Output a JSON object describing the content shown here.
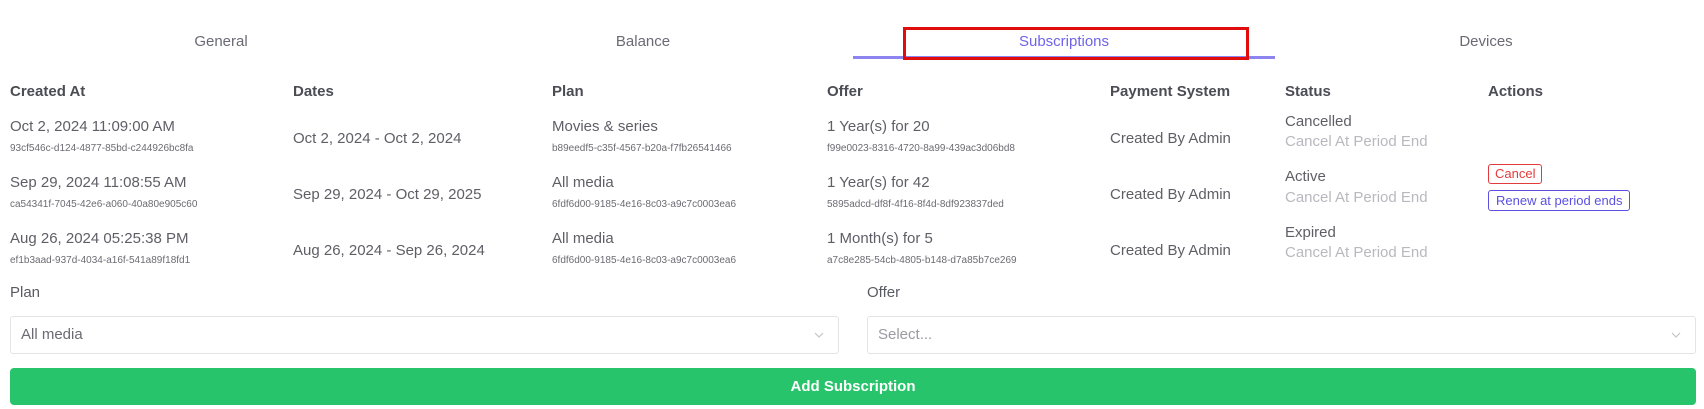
{
  "tabs": [
    {
      "label": "General"
    },
    {
      "label": "Balance"
    },
    {
      "label": "Subscriptions"
    },
    {
      "label": "Devices"
    }
  ],
  "active_tab": "Subscriptions",
  "table": {
    "headers": {
      "created_at": "Created At",
      "dates": "Dates",
      "plan": "Plan",
      "offer": "Offer",
      "payment_system": "Payment System",
      "status": "Status",
      "actions": "Actions"
    },
    "rows": [
      {
        "created_at": "Oct 2, 2024 11:09:00 AM",
        "id": "93cf546c-d124-4877-85bd-c244926bc8fa",
        "dates": "Oct 2, 2024 - Oct 2, 2024",
        "plan": "Movies & series",
        "plan_id": "b89eedf5-c35f-4567-b20a-f7fb26541466",
        "offer": "1 Year(s) for 20",
        "offer_id": "f99e0023-8316-4720-8a99-439ac3d06bd8",
        "payment_system": "Created By Admin",
        "status": "Cancelled",
        "status_note": "Cancel At Period End"
      },
      {
        "created_at": "Sep 29, 2024 11:08:55 AM",
        "id": "ca54341f-7045-42e6-a060-40a80e905c60",
        "dates": "Sep 29, 2024 - Oct 29, 2025",
        "plan": "All media",
        "plan_id": "6fdf6d00-9185-4e16-8c03-a9c7c0003ea6",
        "offer": "1 Year(s) for 42",
        "offer_id": "5895adcd-df8f-4f16-8f4d-8df923837ded",
        "payment_system": "Created By Admin",
        "status": "Active",
        "status_note": "Cancel At Period End",
        "actions": {
          "cancel": "Cancel",
          "renew": "Renew at period ends"
        }
      },
      {
        "created_at": "Aug 26, 2024 05:25:38 PM",
        "id": "ef1b3aad-937d-4034-a16f-541a89f18fd1",
        "dates": "Aug 26, 2024 - Sep 26, 2024",
        "plan": "All media",
        "plan_id": "6fdf6d00-9185-4e16-8c03-a9c7c0003ea6",
        "offer": "1 Month(s) for 5",
        "offer_id": "a7c8e285-54cb-4805-b148-d7a85b7ce269",
        "payment_system": "Created By Admin",
        "status": "Expired",
        "status_note": "Cancel At Period End"
      }
    ]
  },
  "form": {
    "plan_label": "Plan",
    "plan_value": "All media",
    "offer_label": "Offer",
    "offer_placeholder": "Select...",
    "submit_label": "Add Subscription"
  },
  "colors": {
    "accent": "#6f63e8",
    "highlight": "#e00d0d",
    "success": "#27c46b",
    "danger": "#e23b3b"
  }
}
